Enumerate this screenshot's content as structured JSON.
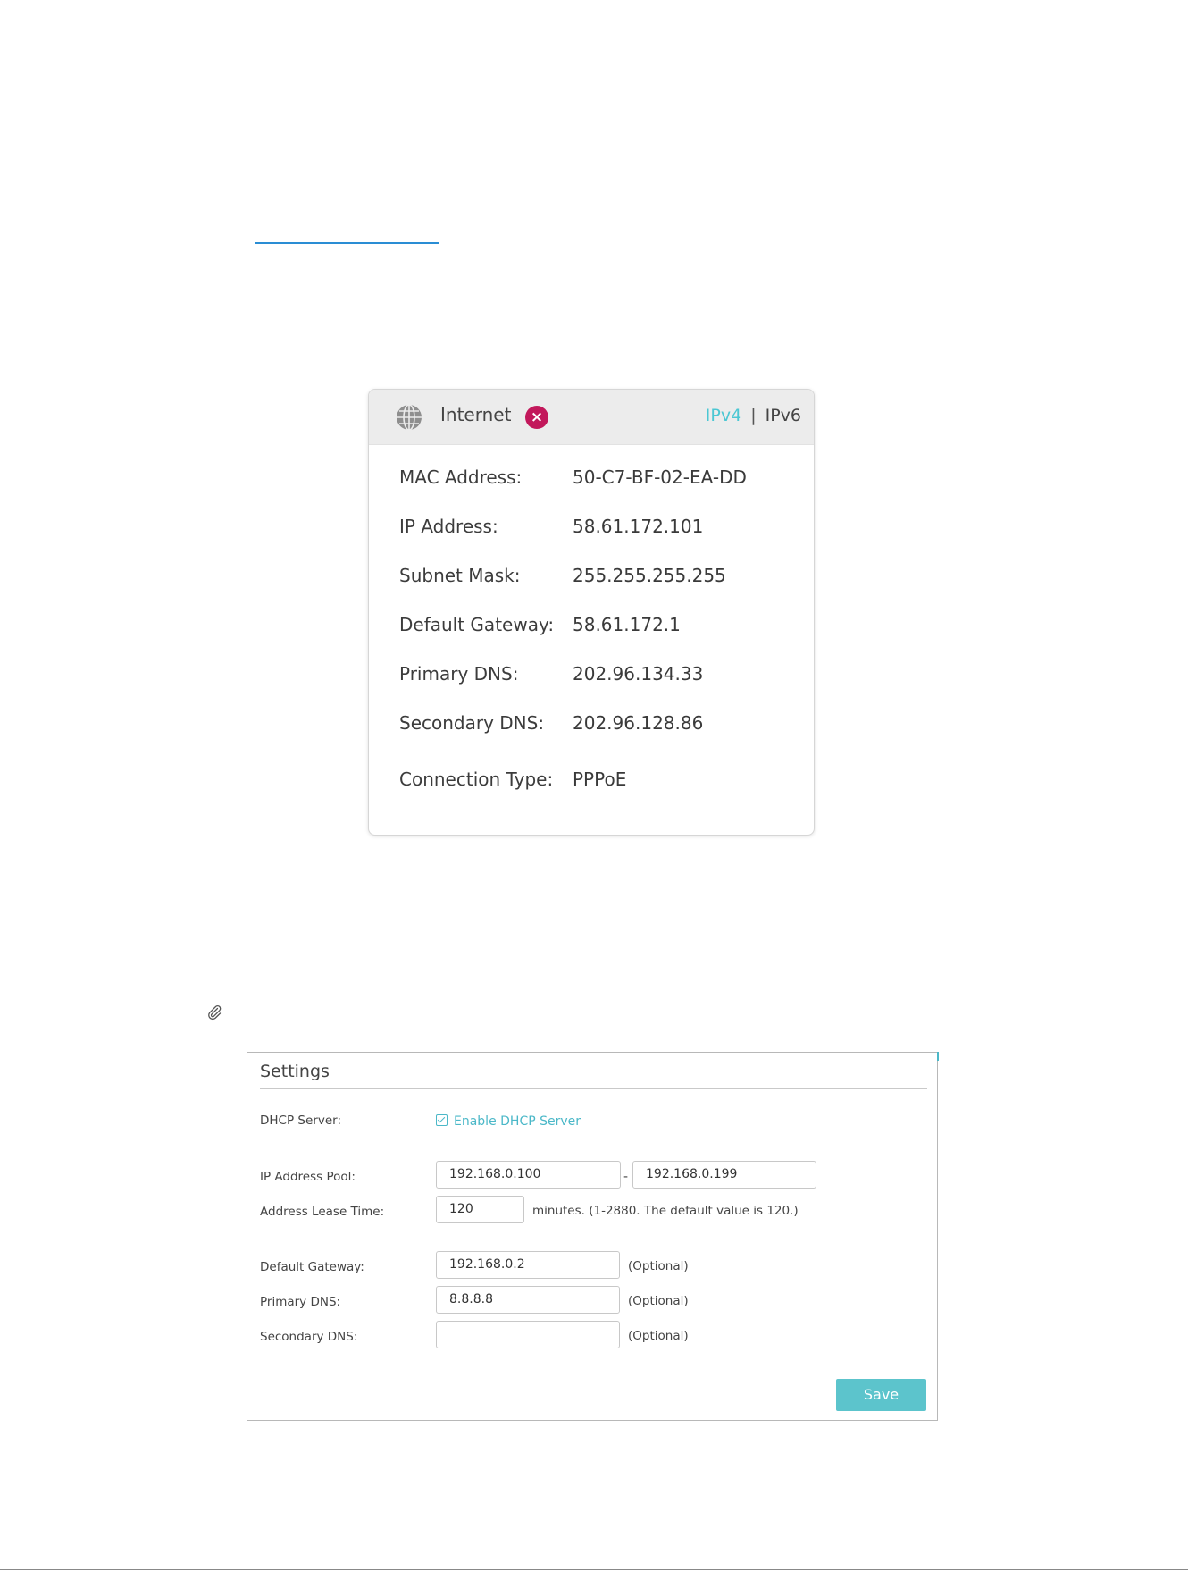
{
  "internet_card": {
    "title": "Internet",
    "status": "disconnected",
    "tab_ipv4": "IPv4",
    "tab_separator": "|",
    "tab_ipv6": "IPv6",
    "rows": [
      {
        "label": "MAC Address:",
        "value": "50-C7-BF-02-EA-DD"
      },
      {
        "label": "IP Address:",
        "value": "58.61.172.101"
      },
      {
        "label": "Subnet Mask:",
        "value": "255.255.255.255"
      },
      {
        "label": "Default Gateway:",
        "value": "58.61.172.1"
      },
      {
        "label": "Primary DNS:",
        "value": "202.96.134.33"
      },
      {
        "label": "Secondary DNS:",
        "value": "202.96.128.86"
      },
      {
        "label": "Connection Type:",
        "value": "PPPoE"
      }
    ],
    "colors": {
      "header_bg": "#ececec",
      "active_tab": "#4bc7d3",
      "error_icon": "#c2185b"
    }
  },
  "settings": {
    "title": "Settings",
    "dhcp_label": "DHCP Server:",
    "dhcp_checkbox_label": "Enable DHCP Server",
    "dhcp_enabled": true,
    "pool_label": "IP Address Pool:",
    "pool_start": "192.168.0.100",
    "pool_dash": "-",
    "pool_end": "192.168.0.199",
    "lease_label": "Address Lease Time:",
    "lease_value": "120",
    "lease_note": "minutes. (1-2880. The default value is 120.)",
    "gateway_label": "Default Gateway:",
    "gateway_value": "192.168.0.2",
    "primary_dns_label": "Primary DNS:",
    "primary_dns_value": "8.8.8.8",
    "secondary_dns_label": "Secondary DNS:",
    "secondary_dns_value": "",
    "optional_note": "(Optional)",
    "save_label": "Save",
    "colors": {
      "accent": "#5cc4cc"
    }
  },
  "icons": {
    "globe": "globe-icon",
    "error": "close-circle-icon",
    "paperclip": "paperclip-icon",
    "checkbox": "checkbox-checked-icon"
  }
}
